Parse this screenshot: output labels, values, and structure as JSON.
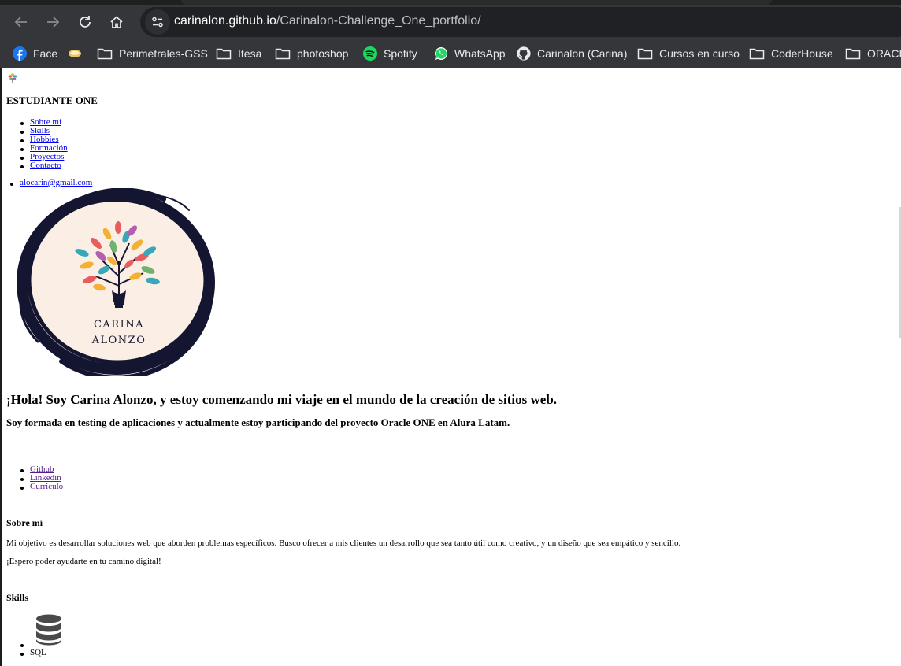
{
  "browser": {
    "url_host": "carinalon.github.io",
    "url_path": "/Carinalon-Challenge_One_portfolio/",
    "bookmarks": [
      {
        "label": "Face",
        "icon": "facebook-icon"
      },
      {
        "label": "",
        "icon": "coin-icon"
      },
      {
        "label": "Perimetrales-GSS",
        "icon": "folder-icon"
      },
      {
        "label": "Itesa",
        "icon": "folder-icon"
      },
      {
        "label": "photoshop",
        "icon": "folder-icon"
      },
      {
        "label": "Spotify",
        "icon": "spotify-icon"
      },
      {
        "label": "WhatsApp",
        "icon": "whatsapp-icon"
      },
      {
        "label": "Carinalon (Carina)",
        "icon": "github-icon"
      },
      {
        "label": "Cursos en curso",
        "icon": "folder-icon"
      },
      {
        "label": "CoderHouse",
        "icon": "folder-icon"
      },
      {
        "label": "ORACLE",
        "icon": "folder-icon"
      }
    ]
  },
  "header": {
    "title": "ESTUDIANTE ONE",
    "nav": [
      "Sobre mí",
      "Skills",
      "Hobbies",
      "Formación",
      "Proyectos",
      "Contacto"
    ],
    "email": "alocarin@gmail.com"
  },
  "logo": {
    "line1": "CARINA",
    "line2": "ALONZO"
  },
  "hero": {
    "heading": "¡Hola! Soy Carina Alonzo, y estoy comenzando mi viaje en el mundo de la creación de sitios web.",
    "subheading": "Soy formada en testing de aplicaciones y actualmente estoy participando del proyecto Oracle ONE en Alura Latam.",
    "links": [
      "Github",
      "Linkedin",
      "Curriculo"
    ]
  },
  "about": {
    "title": "Sobre mí",
    "p1": "Mi objetivo es desarrollar soluciones web que aborden problemas específicos. Busco ofrecer a mis clientes un desarrollo que sea tanto útil como creativo, y un diseño que sea empático y sencillo.",
    "p2": "¡Espero poder ayudarte en tu camino digital!"
  },
  "skills": {
    "title": "Skills",
    "items": [
      {
        "label": "SQL",
        "icon": "database-icon"
      }
    ]
  }
}
